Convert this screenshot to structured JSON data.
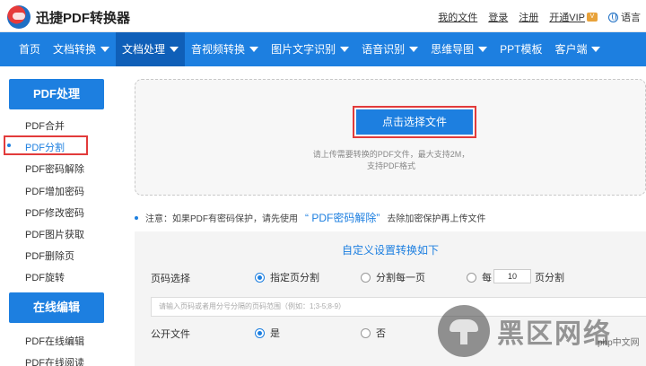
{
  "header": {
    "logo_text": "迅捷PDF转换器",
    "links": [
      "我的文件",
      "登录",
      "注册",
      "开通VIP"
    ],
    "vip_badge": "V",
    "language": "语言"
  },
  "nav": {
    "items": [
      {
        "label": "首页",
        "dropdown": false
      },
      {
        "label": "文档转换",
        "dropdown": true
      },
      {
        "label": "文档处理",
        "dropdown": true
      },
      {
        "label": "音视频转换",
        "dropdown": true
      },
      {
        "label": "图片文字识别",
        "dropdown": true
      },
      {
        "label": "语音识别",
        "dropdown": true
      },
      {
        "label": "思维导图",
        "dropdown": true
      },
      {
        "label": "PPT模板",
        "dropdown": false
      },
      {
        "label": "客户端",
        "dropdown": true
      }
    ],
    "active": "文档处理"
  },
  "sidebar": {
    "section1_title": "PDF处理",
    "section1_items": [
      "PDF合并",
      "PDF分割",
      "PDF密码解除",
      "PDF增加密码",
      "PDF修改密码",
      "PDF图片获取",
      "PDF删除页",
      "PDF旋转"
    ],
    "selected": "PDF分割",
    "section2_title": "在线编辑",
    "section2_items": [
      "PDF在线编辑",
      "PDF在线阅读"
    ]
  },
  "upload": {
    "button_label": "点击选择文件",
    "tip_line1": "请上传需要转换的PDF文件，最大支持2M，",
    "tip_line2": "支持PDF格式"
  },
  "notice": {
    "prefix": "注意：如果PDF有密码保护，请先使用",
    "link": "“ PDF密码解除”",
    "suffix": "去除加密保护再上传文件"
  },
  "settings": {
    "title": "自定义设置转换如下",
    "page_select_label": "页码选择",
    "options": [
      "指定页分割",
      "分割每一页",
      "每",
      "页分割"
    ],
    "every_n_value": "10",
    "range_placeholder": "请输入页码或者用分号分隔的页码范围（例如：1;3-5;8-9）",
    "public_label": "公开文件",
    "yes": "是",
    "no": "否"
  },
  "watermark": {
    "text": "黑区网络",
    "sub": "php中文网"
  },
  "colors": {
    "primary": "#1d7fe0",
    "nav_active": "#0f5fb8",
    "highlight_red": "#e23b3b"
  }
}
